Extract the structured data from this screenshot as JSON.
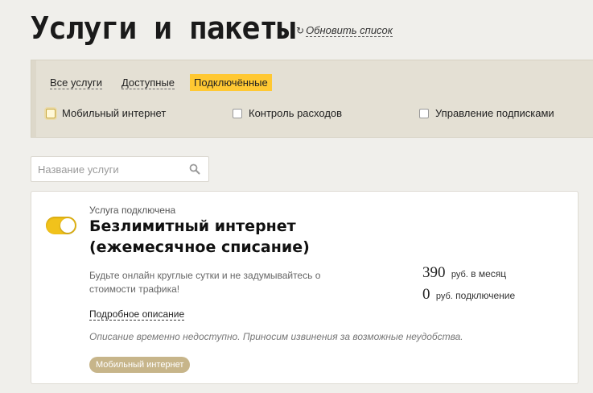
{
  "header": {
    "title": "Услуги и пакеты",
    "refresh_label": "Обновить список",
    "refresh_icon": "refresh-icon"
  },
  "tabs": [
    {
      "label": "Все услуги",
      "active": false
    },
    {
      "label": "Доступные",
      "active": false
    },
    {
      "label": "Подключённые",
      "active": true
    }
  ],
  "filters": [
    {
      "label": "Мобильный интернет",
      "checked": false
    },
    {
      "label": "Контроль расходов",
      "checked": false
    },
    {
      "label": "Управление подписками",
      "checked": false
    }
  ],
  "search": {
    "placeholder": "Название услуги",
    "value": "",
    "icon": "search-icon"
  },
  "service": {
    "status": "Услуга подключена",
    "enabled": true,
    "title": "Безлимитный интернет (ежемесячное списание)",
    "description": "Будьте онлайн круглые сутки и не задумывайтесь о стоимости трафика!",
    "more_link": "Подробное описание",
    "notice": "Описание временно недоступно. Приносим извинения за возможные неудобства.",
    "tag": "Мобильный интернет",
    "prices": [
      {
        "amount": "390",
        "currency": "руб.",
        "period": "в месяц"
      },
      {
        "amount": "0",
        "currency": "руб.",
        "period": "подключение"
      }
    ]
  },
  "colors": {
    "accent": "#ffc832",
    "toggle": "#f1c21b",
    "tag": "#c7b58a",
    "background": "#f0efeb"
  }
}
